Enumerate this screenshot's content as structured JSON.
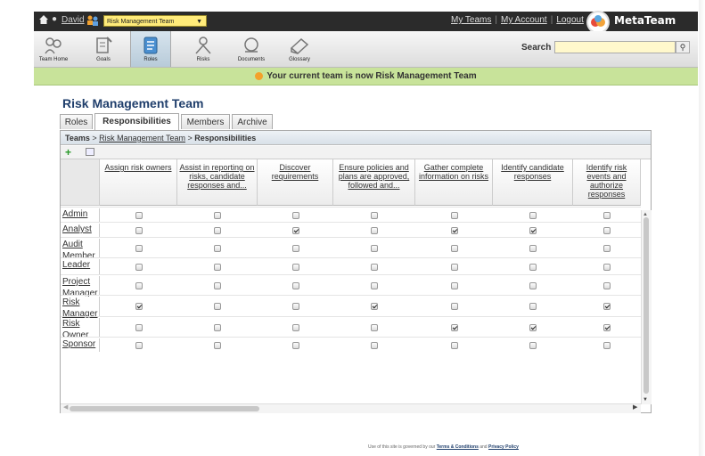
{
  "topbar": {
    "user": "David",
    "team_select": "Risk Management Team",
    "links": [
      "My Teams",
      "My Account",
      "Logout"
    ],
    "logo": "MetaTeam"
  },
  "toolbar": {
    "items": [
      {
        "label": "Team Home",
        "icon": "team-home-icon"
      },
      {
        "label": "Goals",
        "icon": "goals-icon"
      },
      {
        "label": "Roles",
        "icon": "roles-icon"
      },
      {
        "label": "Risks",
        "icon": "risks-icon"
      },
      {
        "label": "Documents",
        "icon": "documents-icon"
      },
      {
        "label": "Glossary",
        "icon": "glossary-icon"
      }
    ],
    "active": "Roles",
    "search_label": "Search"
  },
  "notice": "Your current team is now Risk Management Team",
  "page_title": "Risk Management Team",
  "tabs": [
    "Roles",
    "Responsibilities",
    "Members",
    "Archive"
  ],
  "active_tab": "Responsibilities",
  "breadcrumb": {
    "root": "Teams",
    "team": "Risk Management Team",
    "current": "Responsibilities"
  },
  "columns": [
    "Assign risk owners",
    "Assist in reporting on risks, candidate responses and...",
    "Discover requirements",
    "Ensure policies and plans are approved, followed and...",
    "Gather complete information on risks",
    "Identify candidate responses",
    "Identify risk events and authorize responses"
  ],
  "rows": [
    {
      "role": "Admin",
      "checks": [
        false,
        false,
        false,
        false,
        false,
        false,
        false
      ]
    },
    {
      "role": "Analyst",
      "checks": [
        false,
        false,
        true,
        false,
        true,
        true,
        false
      ]
    },
    {
      "role": "Audit Member",
      "checks": [
        false,
        false,
        false,
        false,
        false,
        false,
        false
      ]
    },
    {
      "role": "Leader",
      "checks": [
        false,
        false,
        false,
        false,
        false,
        false,
        false
      ]
    },
    {
      "role": "Project Manager",
      "checks": [
        false,
        false,
        false,
        false,
        false,
        false,
        false
      ]
    },
    {
      "role": "Risk Manager",
      "checks": [
        true,
        false,
        false,
        true,
        false,
        false,
        true
      ]
    },
    {
      "role": "Risk Owner",
      "checks": [
        false,
        false,
        false,
        false,
        true,
        true,
        true
      ]
    },
    {
      "role": "Sponsor",
      "checks": [
        false,
        false,
        false,
        false,
        false,
        false,
        false
      ]
    }
  ],
  "footer": {
    "legal_prefix": "Use of this site is governed by our",
    "terms": "Terms & Conditions",
    "and": "and",
    "privacy": "Privacy Policy"
  },
  "colors": {
    "topbar": "#2b2b2b",
    "notice": "#c8e39a",
    "title": "#1f3e6b",
    "select": "#ffeb7a"
  }
}
